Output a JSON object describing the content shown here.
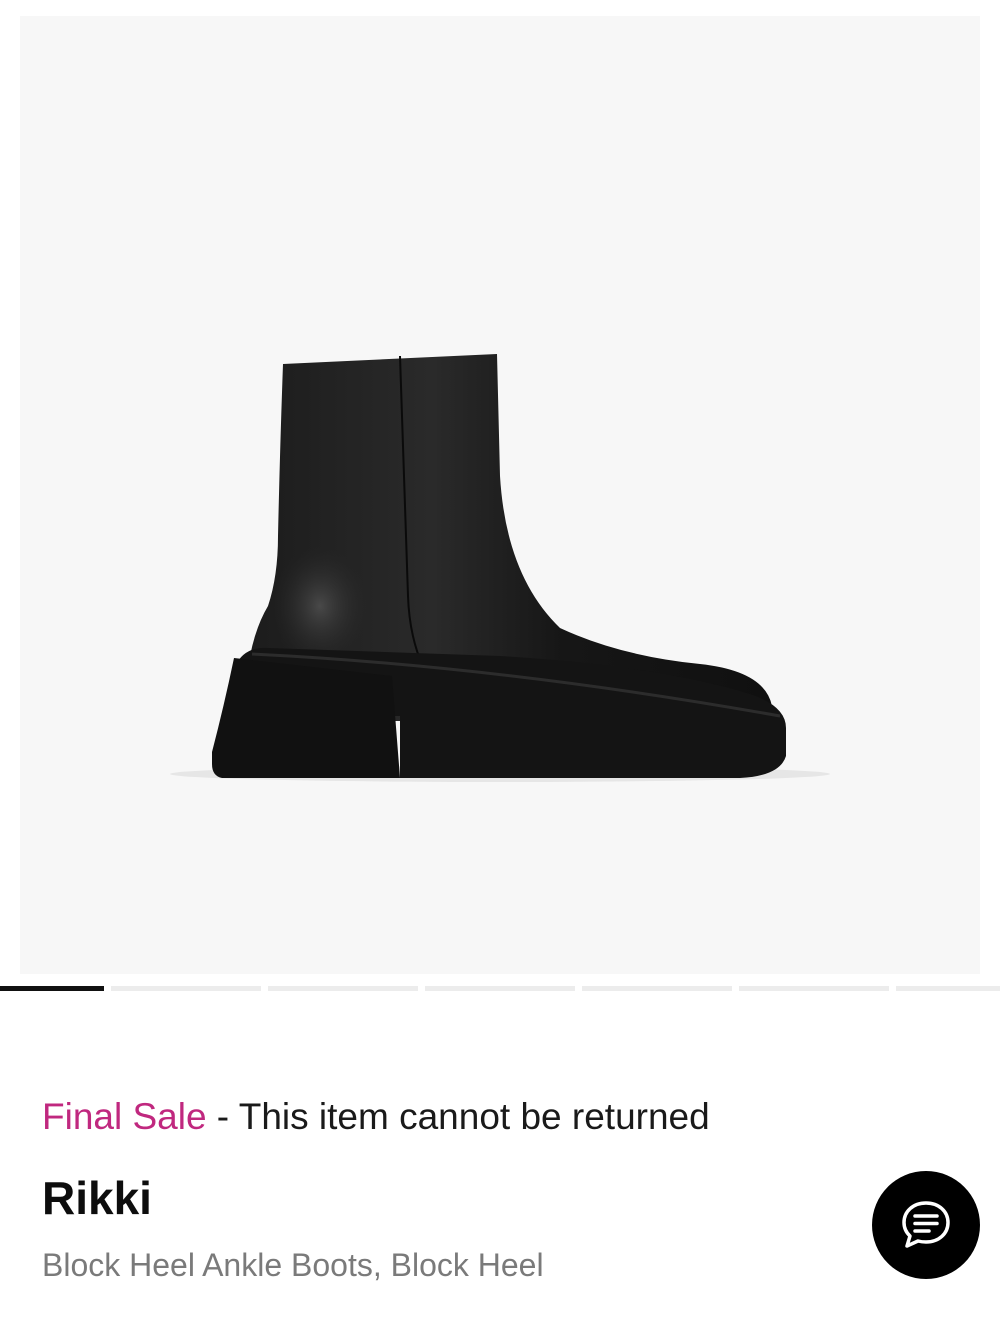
{
  "gallery": {
    "image_alt": "Black leather block heel ankle boot",
    "slide_count": 7,
    "active_slide": 1
  },
  "notice": {
    "final_sale": "Final Sale",
    "message": " - This item cannot be returned",
    "accent_color": "#c0287f"
  },
  "product": {
    "brand": "Rikki",
    "name": "Block Heel Ankle Boots, Block Heel"
  },
  "chat": {
    "icon": "chat-bubble-icon"
  }
}
